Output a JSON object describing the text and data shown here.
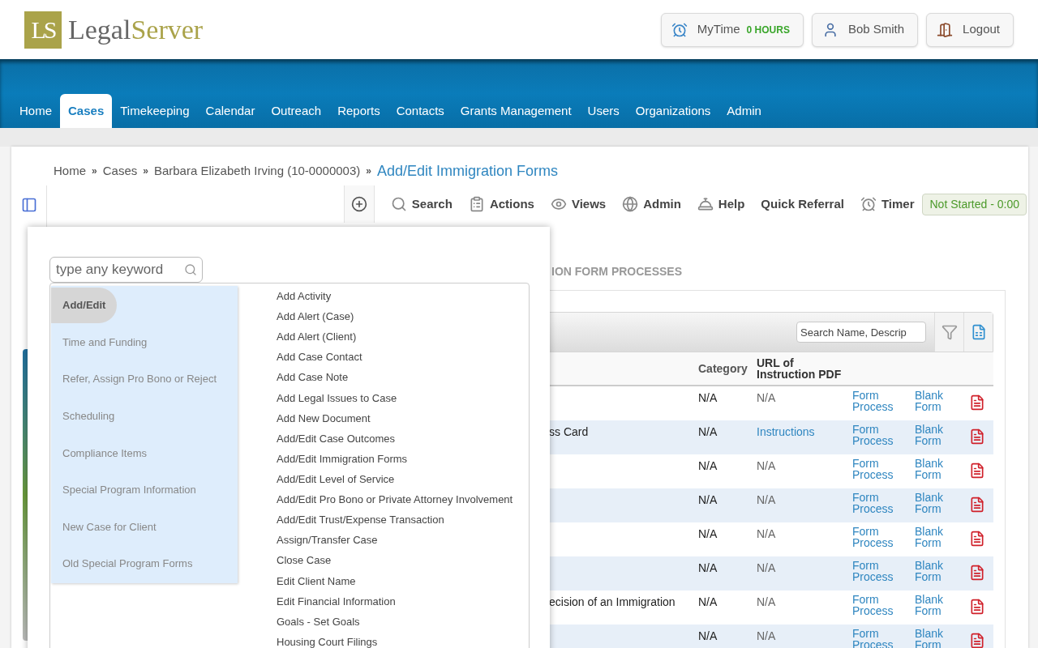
{
  "logo": {
    "mark": "LS",
    "name_part_1": "Legal",
    "name_part_2": "Server"
  },
  "user_buttons": [
    {
      "kind": "mytime",
      "label": "MyTime",
      "value": "0 HOURS"
    },
    {
      "kind": "user",
      "label": "Bob Smith"
    },
    {
      "kind": "logout",
      "label": "Logout"
    }
  ],
  "nav_tabs": [
    {
      "label": "Home",
      "selected": false
    },
    {
      "label": "Cases",
      "selected": true
    },
    {
      "label": "Timekeeping",
      "selected": false
    },
    {
      "label": "Calendar",
      "selected": false
    },
    {
      "label": "Outreach",
      "selected": false
    },
    {
      "label": "Reports",
      "selected": false
    },
    {
      "label": "Contacts",
      "selected": false
    },
    {
      "label": "Grants Management",
      "selected": false
    },
    {
      "label": "Users",
      "selected": false
    },
    {
      "label": "Organizations",
      "selected": false
    },
    {
      "label": "Admin",
      "selected": false
    }
  ],
  "breadcrumb": {
    "items": [
      {
        "label": "Home",
        "separator": "»"
      },
      {
        "label": "Cases",
        "separator": "»"
      },
      {
        "label": "Barbara Elizabeth Irving (10-0000003)",
        "separator": "»"
      }
    ],
    "current": "Add/Edit Immigration Forms"
  },
  "toolbar": {
    "items": [
      {
        "kind": "add"
      },
      {
        "kind": "search",
        "label": "Search"
      },
      {
        "kind": "actions",
        "label": "Actions"
      },
      {
        "kind": "views",
        "label": "Views"
      },
      {
        "kind": "admin",
        "label": "Admin"
      },
      {
        "kind": "help",
        "label": "Help"
      },
      {
        "kind": "referral",
        "label": "Quick Referral"
      },
      {
        "kind": "timer",
        "label": "Timer"
      }
    ],
    "timer_status": "Not Started - 0:00"
  },
  "page": {
    "section_title": "ION FORM PROCESSES",
    "table": {
      "search": {
        "placeholder": "Search Name, Descrip"
      },
      "columns": [
        "Category",
        "URL of Instruction PDF"
      ],
      "rows": [
        {
          "category": "N/A",
          "url": {
            "kind": "text",
            "text": "N/A"
          },
          "form_process": "Form Process",
          "blank_form": "Blank Form"
        },
        {
          "name": "ss Card",
          "category": "N/A",
          "url": {
            "kind": "link",
            "text": "Instructions"
          },
          "form_process": "Form Process",
          "blank_form": "Blank Form"
        },
        {
          "category": "N/A",
          "url": {
            "kind": "text",
            "text": "N/A"
          },
          "form_process": "Form Process",
          "blank_form": "Blank Form"
        },
        {
          "category": "N/A",
          "url": {
            "kind": "text",
            "text": "N/A"
          },
          "form_process": "Form Process",
          "blank_form": "Blank Form"
        },
        {
          "category": "N/A",
          "url": {
            "kind": "text",
            "text": "N/A"
          },
          "form_process": "Form Process",
          "blank_form": "Blank Form"
        },
        {
          "category": "N/A",
          "url": {
            "kind": "text",
            "text": "N/A"
          },
          "form_process": "Form Process",
          "blank_form": "Blank Form"
        },
        {
          "name": "ecision of an Immigration",
          "category": "N/A",
          "url": {
            "kind": "text",
            "text": "N/A"
          },
          "form_process": "Form Process",
          "blank_form": "Blank Form"
        },
        {
          "category": "N/A",
          "url": {
            "kind": "text",
            "text": "N/A"
          },
          "form_process": "Form Process",
          "blank_form": "Blank Form"
        }
      ]
    }
  },
  "quick_menu": {
    "search": {
      "placeholder": "type any keyword"
    },
    "categories": [
      {
        "label": "Add/Edit",
        "selected": true
      },
      {
        "label": "Time and Funding",
        "selected": false
      },
      {
        "label": "Refer, Assign Pro Bono or Reject",
        "selected": false
      },
      {
        "label": "Scheduling",
        "selected": false
      },
      {
        "label": "Compliance Items",
        "selected": false
      },
      {
        "label": "Special Program Information",
        "selected": false
      },
      {
        "label": "New Case for Client",
        "selected": false
      },
      {
        "label": "Old Special Program Forms",
        "selected": false
      }
    ],
    "actions": [
      "Add Activity",
      "Add Alert (Case)",
      "Add Alert (Client)",
      "Add Case Contact",
      "Add Case Note",
      "Add Legal Issues to Case",
      "Add New Document",
      "Add/Edit Case Outcomes",
      "Add/Edit Immigration Forms",
      "Add/Edit Level of Service",
      "Add/Edit Pro Bono or Private Attorney Involvement",
      "Add/Edit Trust/Expense Transaction",
      "Assign/Transfer Case",
      "Close Case",
      "Edit Client Name",
      "Edit Financial Information",
      "Goals - Set Goals",
      "Housing Court Filings"
    ]
  }
}
